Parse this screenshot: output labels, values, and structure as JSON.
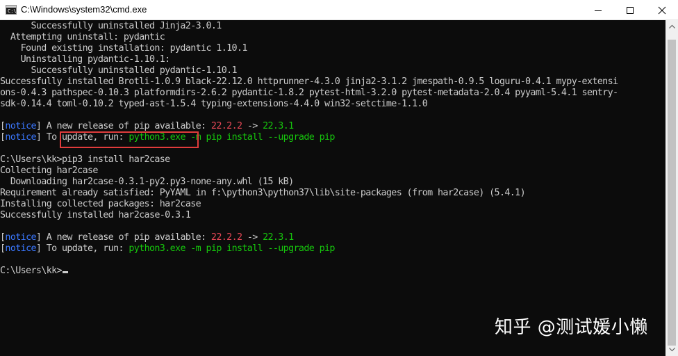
{
  "window": {
    "title": "C:\\Windows\\system32\\cmd.exe",
    "icon": "cmd-icon",
    "icon_glyph": "C:\\"
  },
  "console": {
    "lines": [
      [
        {
          "t": "      Successfully uninstalled Jinja2-3.0.1",
          "c": "default"
        }
      ],
      [
        {
          "t": "  Attempting uninstall: pydantic",
          "c": "default"
        }
      ],
      [
        {
          "t": "    Found existing installation: pydantic 1.10.1",
          "c": "default"
        }
      ],
      [
        {
          "t": "    Uninstalling pydantic-1.10.1:",
          "c": "default"
        }
      ],
      [
        {
          "t": "      Successfully uninstalled pydantic-1.10.1",
          "c": "default"
        }
      ],
      [
        {
          "t": "Successfully installed Brotli-1.0.9 black-22.12.0 httprunner-4.3.0 jinja2-3.1.2 jmespath-0.9.5 loguru-0.4.1 mypy-extensi",
          "c": "default"
        }
      ],
      [
        {
          "t": "ons-0.4.3 pathspec-0.10.3 platformdirs-2.6.2 pydantic-1.8.2 pytest-html-3.2.0 pytest-metadata-2.0.4 pyyaml-5.4.1 sentry-",
          "c": "default"
        }
      ],
      [
        {
          "t": "sdk-0.14.4 toml-0.10.2 typed-ast-1.5.4 typing-extensions-4.4.0 win32-setctime-1.1.0",
          "c": "default"
        }
      ],
      [
        {
          "t": "",
          "c": "default"
        }
      ],
      [
        {
          "t": "[",
          "c": "default"
        },
        {
          "t": "notice",
          "c": "blue"
        },
        {
          "t": "] A new release of pip available: ",
          "c": "default"
        },
        {
          "t": "22.2.2",
          "c": "red"
        },
        {
          "t": " -> ",
          "c": "default"
        },
        {
          "t": "22.3.1",
          "c": "green"
        }
      ],
      [
        {
          "t": "[",
          "c": "default"
        },
        {
          "t": "notice",
          "c": "blue"
        },
        {
          "t": "] To update, run: ",
          "c": "default"
        },
        {
          "t": "python3.exe -m pip install --upgrade pip",
          "c": "green"
        }
      ],
      [
        {
          "t": "",
          "c": "default"
        }
      ],
      [
        {
          "t": "C:\\Users\\kk>pip3 install har2case",
          "c": "default"
        }
      ],
      [
        {
          "t": "Collecting har2case",
          "c": "default"
        }
      ],
      [
        {
          "t": "  Downloading har2case-0.3.1-py2.py3-none-any.whl (15 kB)",
          "c": "default"
        }
      ],
      [
        {
          "t": "Requirement already satisfied: PyYAML in f:\\python3\\python37\\lib\\site-packages (from har2case) (5.4.1)",
          "c": "default"
        }
      ],
      [
        {
          "t": "Installing collected packages: har2case",
          "c": "default"
        }
      ],
      [
        {
          "t": "Successfully installed har2case-0.3.1",
          "c": "default"
        }
      ],
      [
        {
          "t": "",
          "c": "default"
        }
      ],
      [
        {
          "t": "[",
          "c": "default"
        },
        {
          "t": "notice",
          "c": "blue"
        },
        {
          "t": "] A new release of pip available: ",
          "c": "default"
        },
        {
          "t": "22.2.2",
          "c": "red"
        },
        {
          "t": " -> ",
          "c": "default"
        },
        {
          "t": "22.3.1",
          "c": "green"
        }
      ],
      [
        {
          "t": "[",
          "c": "default"
        },
        {
          "t": "notice",
          "c": "blue"
        },
        {
          "t": "] To update, run: ",
          "c": "default"
        },
        {
          "t": "python3.exe -m pip install --upgrade pip",
          "c": "green"
        }
      ],
      [
        {
          "t": "",
          "c": "default"
        }
      ],
      [
        {
          "t": "C:\\Users\\kk>",
          "c": "default"
        }
      ]
    ]
  },
  "watermark": "知乎 @测试媛小懒",
  "colors": {
    "background": "#0c0c0c",
    "text": "#cccccc",
    "notice_blue": "#3b78ff",
    "version_red": "#e74856",
    "version_green": "#16c60c",
    "highlight_box": "#e03c3c"
  }
}
